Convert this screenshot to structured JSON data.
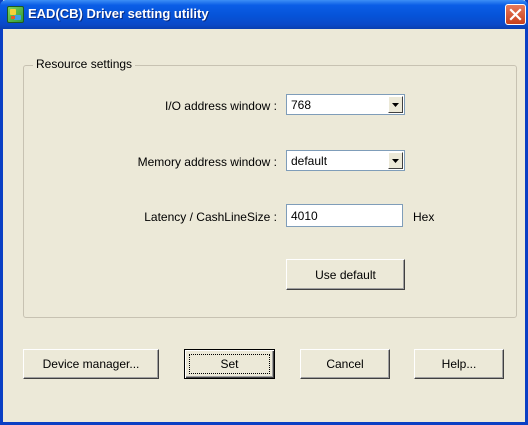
{
  "window": {
    "title": "EAD(CB) Driver setting utility",
    "icon": "app-icon",
    "close_icon": "close-icon"
  },
  "resource_settings": {
    "legend": "Resource settings",
    "io_address": {
      "label": "I/O address window :",
      "value": "768"
    },
    "memory_address": {
      "label": "Memory address window :",
      "value": "default"
    },
    "latency": {
      "label": "Latency / CashLineSize :",
      "value": "4010",
      "unit": "Hex"
    },
    "use_default_label": "Use default"
  },
  "buttons": {
    "device_manager": "Device manager...",
    "set": "Set",
    "cancel": "Cancel",
    "help": "Help..."
  },
  "colors": {
    "titlebar": "#0653d8",
    "close_button": "#c8401c",
    "dialog_bg": "#ece9d8",
    "field_border": "#7f9db9"
  }
}
